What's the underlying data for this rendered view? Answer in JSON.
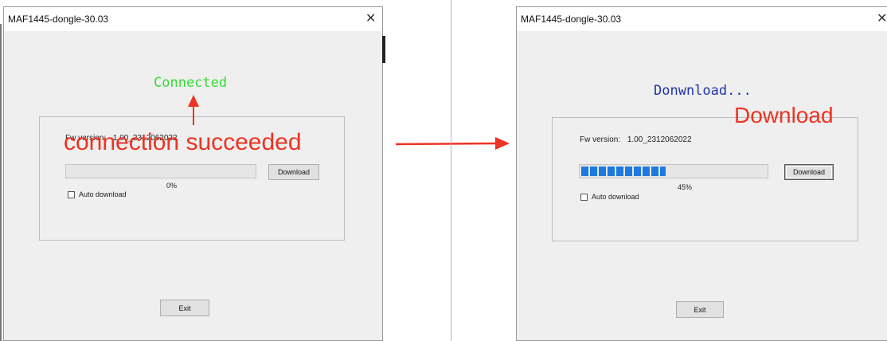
{
  "left": {
    "title": "MAF1445-dongle-30.03",
    "close_glyph": "✕",
    "status": "Connected",
    "status_color": "#33dd33",
    "fw_label": "Fw version:",
    "fw_value": "1.00_2312062022",
    "progress_value": 0,
    "progress_text": "0%",
    "download_label": "Download",
    "auto_label": "Auto download",
    "exit_label": "Exit",
    "annotation": "connection succeeded"
  },
  "right": {
    "title": "MAF1445-dongle-30.03",
    "close_glyph": "✕",
    "status": "Donwnload...",
    "status_color": "#2233aa",
    "fw_label": "Fw version:",
    "fw_value": "1.00_2312062022",
    "progress_value": 0.45,
    "progress_text": "45%",
    "download_label": "Download",
    "auto_label": "Auto download",
    "exit_label": "Exit",
    "annotation": "Download"
  },
  "annotation_color": "#ee3322"
}
